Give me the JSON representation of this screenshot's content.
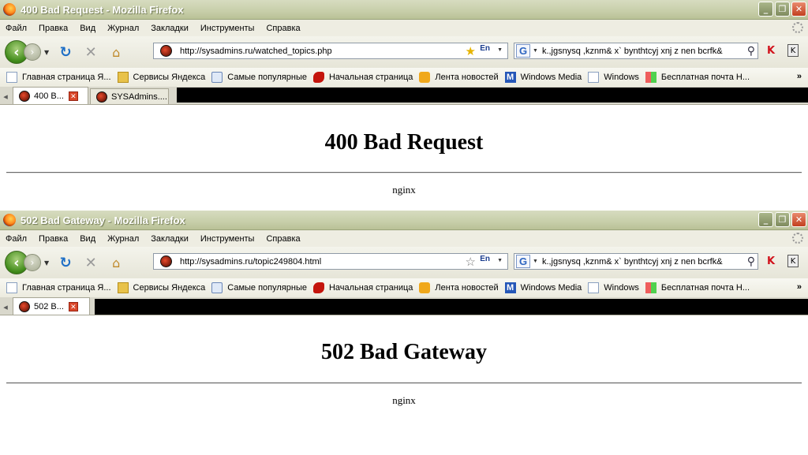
{
  "windows": [
    {
      "title": "400 Bad Request - Mozilla Firefox",
      "menu": [
        "Файл",
        "Правка",
        "Вид",
        "Журнал",
        "Закладки",
        "Инструменты",
        "Справка"
      ],
      "url": "http://sysadmins.ru/watched_topics.php",
      "bookmarked": true,
      "lang": "En",
      "search_text": "k.,jgsnysq ,kznm& x` bynthtcyj xnj z nen bcrfk&",
      "bookmarks": [
        "Главная страница Я...",
        "Сервисы Яндекса",
        "Самые популярные",
        "Начальная страница",
        "Лента новостей",
        "Windows Media",
        "Windows",
        "Бесплатная почта Н..."
      ],
      "tabs": [
        "400 B...",
        "SYSAdmins...."
      ],
      "page_heading": "400 Bad Request",
      "server": "nginx"
    },
    {
      "title": "502 Bad Gateway - Mozilla Firefox",
      "menu": [
        "Файл",
        "Правка",
        "Вид",
        "Журнал",
        "Закладки",
        "Инструменты",
        "Справка"
      ],
      "url": "http://sysadmins.ru/topic249804.html",
      "bookmarked": false,
      "lang": "En",
      "search_text": "k.,jgsnysq ,kznm& x` bynthtcyj xnj z nen bcrfk&",
      "bookmarks": [
        "Главная страница Я...",
        "Сервисы Яндекса",
        "Самые популярные",
        "Начальная страница",
        "Лента новостей",
        "Windows Media",
        "Windows",
        "Бесплатная почта Н..."
      ],
      "tabs": [
        "502 B..."
      ],
      "page_heading": "502 Bad Gateway",
      "server": "nginx"
    }
  ],
  "icons": {
    "back": "back-arrow-icon",
    "forward": "forward-arrow-icon",
    "reload": "reload-icon",
    "stop": "stop-icon",
    "home": "home-icon",
    "search": "magnifier-icon",
    "bookmark": "star-icon",
    "overflow": "chevron-double-right-icon"
  },
  "colors": {
    "titlebar": "#c7cea9",
    "close_button": "#c2401f",
    "tab_close": "#d94629"
  }
}
